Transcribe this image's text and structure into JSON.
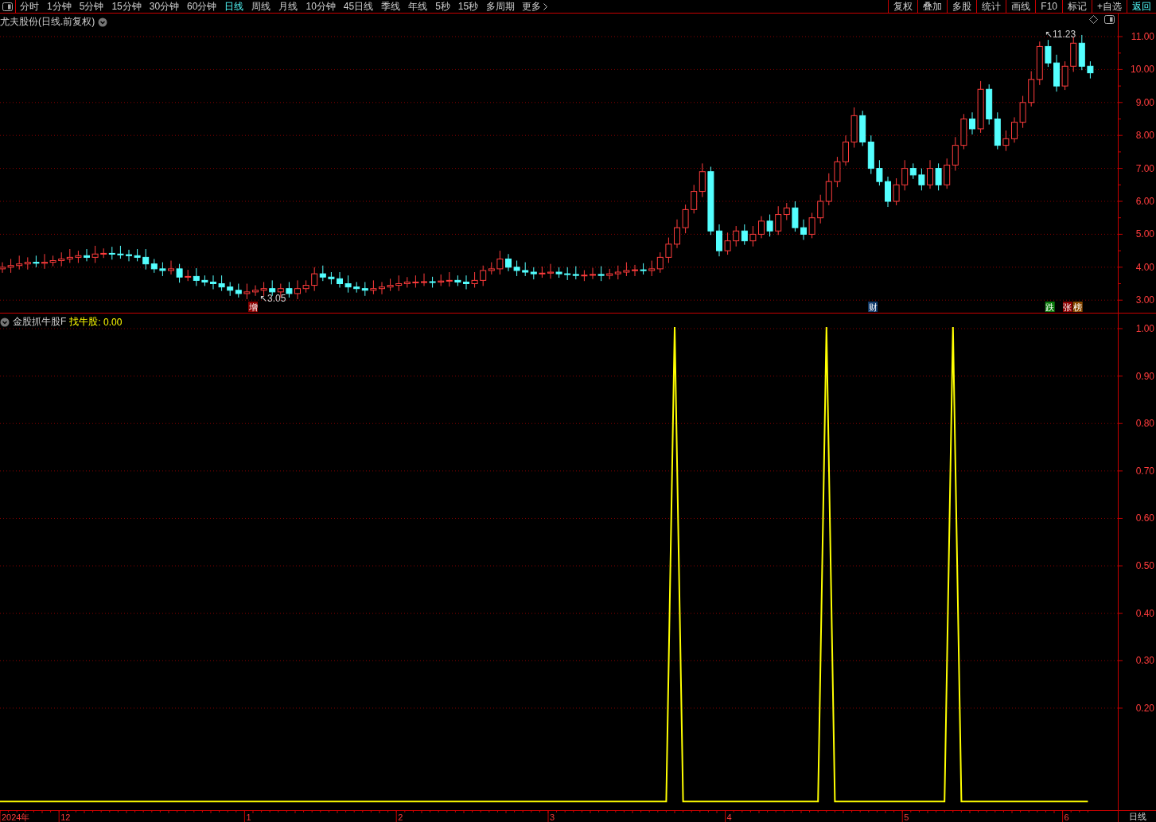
{
  "toolbar": {
    "periods": [
      {
        "label": "分时",
        "selected": false
      },
      {
        "label": "1分钟",
        "selected": false
      },
      {
        "label": "5分钟",
        "selected": false
      },
      {
        "label": "15分钟",
        "selected": false
      },
      {
        "label": "30分钟",
        "selected": false
      },
      {
        "label": "60分钟",
        "selected": false
      },
      {
        "label": "日线",
        "selected": true
      },
      {
        "label": "周线",
        "selected": false
      },
      {
        "label": "月线",
        "selected": false
      },
      {
        "label": "10分钟",
        "selected": false
      },
      {
        "label": "45日线",
        "selected": false
      },
      {
        "label": "季线",
        "selected": false
      },
      {
        "label": "年线",
        "selected": false
      },
      {
        "label": "5秒",
        "selected": false
      },
      {
        "label": "15秒",
        "selected": false
      },
      {
        "label": "多周期",
        "selected": false
      }
    ],
    "more": "更多",
    "actions": [
      {
        "label": "复权",
        "active": false
      },
      {
        "label": "叠加",
        "active": false
      },
      {
        "label": "多股",
        "active": false
      },
      {
        "label": "统计",
        "active": false
      },
      {
        "label": "画线",
        "active": false
      },
      {
        "label": "F10",
        "active": false
      },
      {
        "label": "标记",
        "active": false
      },
      {
        "label": "+自选",
        "active": false
      },
      {
        "label": "返回",
        "active": true
      }
    ]
  },
  "price_pane": {
    "title": "尤夫股份(日线.前复权)",
    "high_label": "↖11.23",
    "low_label": "↖3.05",
    "axis_labels": [
      "11.00",
      "10.00",
      "9.00",
      "8.00",
      "7.00",
      "6.00",
      "5.00",
      "4.00",
      "3.00"
    ],
    "badges": [
      {
        "text": "增",
        "color": "#8b0000"
      },
      {
        "text": "财",
        "color": "#123c6c"
      },
      {
        "text": "跌",
        "color": "#0a7a0a"
      },
      {
        "text": "张",
        "color": "#8b0000"
      },
      {
        "text": "榜",
        "color": "#8b4a00"
      }
    ]
  },
  "indicator_pane": {
    "name": "金股抓牛股F",
    "reading": ": 0.00",
    "chart_data": {
      "type": "line",
      "ylim": [
        -0.04,
        1
      ],
      "grid": true,
      "yticks": [
        {
          "value": 0.2,
          "label": "0.20"
        },
        {
          "value": 0.3,
          "label": "0.30"
        },
        {
          "value": 0.4,
          "label": "0.40"
        },
        {
          "value": 0.5,
          "label": "0.50"
        },
        {
          "value": 0.6,
          "label": "0.60"
        },
        {
          "value": 0.7,
          "label": "0.70"
        },
        {
          "value": 0.8,
          "label": "0.80"
        },
        {
          "value": 0.9,
          "label": "0.90"
        },
        {
          "value": 1.0,
          "label": "1.00"
        }
      ],
      "series": [
        {
          "name": "找牛股",
          "color": "#ffff00",
          "values": [
            0,
            0,
            0,
            0,
            0,
            0,
            0,
            0,
            0,
            0,
            0,
            0,
            0,
            0,
            0,
            0,
            0,
            0,
            0,
            0,
            0,
            0,
            0,
            0,
            0,
            0,
            0,
            0,
            0,
            0,
            0,
            0,
            0,
            0,
            0,
            0,
            0,
            0,
            0,
            0,
            0,
            0,
            0,
            0,
            0,
            0,
            0,
            0,
            0,
            0,
            0,
            0,
            0,
            0,
            0,
            0,
            0,
            0,
            0,
            0,
            0,
            0,
            0,
            0,
            0,
            0,
            0,
            0,
            0,
            0,
            0,
            0,
            0,
            0,
            0,
            0,
            0,
            0,
            0,
            0,
            1,
            0,
            0,
            0,
            0,
            0,
            0,
            0,
            0,
            0,
            0,
            0,
            0,
            0,
            0,
            0,
            0,
            0,
            1,
            0,
            0,
            0,
            0,
            0,
            0,
            0,
            0,
            0,
            0,
            0,
            0,
            0,
            0,
            1,
            0,
            0,
            0,
            0,
            0,
            0,
            0,
            0,
            0,
            0,
            0,
            0,
            0,
            0,
            0,
            0
          ]
        }
      ]
    }
  },
  "time_axis": [
    "2024年",
    "12",
    "1",
    "2",
    "3",
    "4",
    "5",
    "6"
  ],
  "period_label": "日线"
}
